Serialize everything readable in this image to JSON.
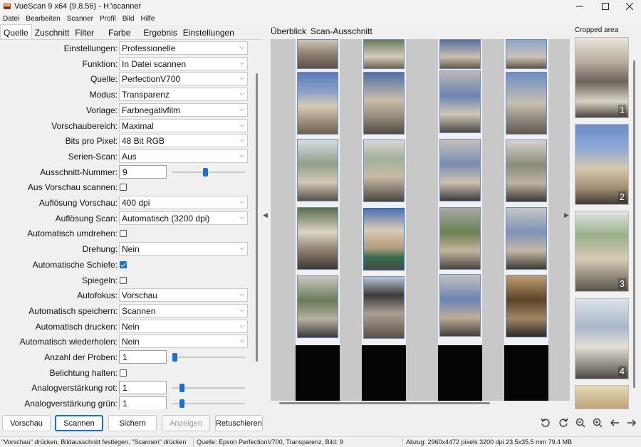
{
  "window": {
    "title": "VueScan 9 x64 (9.8.56) - H:\\scanner",
    "minimize_icon": "minimize-icon",
    "maximize_icon": "maximize-icon",
    "close_icon": "close-icon"
  },
  "menu": [
    "Datei",
    "Bearbeiten",
    "Scanner",
    "Profil",
    "Bild",
    "Hilfe"
  ],
  "tabs": [
    "Quelle",
    "Zuschnitt",
    "Filter",
    "Farbe",
    "Ergebnis",
    "Einstellungen"
  ],
  "active_tab": "Quelle",
  "form": {
    "einstellungen": {
      "label": "Einstellungen:",
      "value": "Professionelle"
    },
    "funktion": {
      "label": "Funktion:",
      "value": "In Datei scannen"
    },
    "quelle": {
      "label": "Quelle:",
      "value": "PerfectionV700"
    },
    "modus": {
      "label": "Modus:",
      "value": "Transparenz"
    },
    "vorlage": {
      "label": "Vorlage:",
      "value": "Farbnegativfilm"
    },
    "vorschaubereich": {
      "label": "Vorschaubereich:",
      "value": "Maximal"
    },
    "bits": {
      "label": "Bits pro Pixel:",
      "value": "48 Bit RGB"
    },
    "serien": {
      "label": "Serien-Scan:",
      "value": "Aus"
    },
    "ausschnitt": {
      "label": "Ausschnitt-Nummer:",
      "value": "9",
      "slider_fraction": 0.45
    },
    "aus_vorschau": {
      "label": "Aus Vorschau scannen:",
      "checked": false
    },
    "aufl_vorschau": {
      "label": "Auflösung Vorschau:",
      "value": "400 dpi"
    },
    "aufl_scan": {
      "label": "Auflösung Scan:",
      "value": "Automatisch (3200 dpi)"
    },
    "umdrehen": {
      "label": "Automatisch umdrehen:",
      "checked": false
    },
    "drehung": {
      "label": "Drehung:",
      "value": "Nein"
    },
    "schiefe": {
      "label": "Automatische Schiefe:",
      "checked": true
    },
    "spiegeln": {
      "label": "Spiegeln:",
      "checked": false
    },
    "autofokus": {
      "label": "Autofokus:",
      "value": "Vorschau"
    },
    "auto_speichern": {
      "label": "Automatisch speichern:",
      "value": "Scannen"
    },
    "auto_drucken": {
      "label": "Automatisch drucken:",
      "value": "Nein"
    },
    "auto_wiederholen": {
      "label": "Automatisch wiederholen:",
      "value": "Nein"
    },
    "proben": {
      "label": "Anzahl der Proben:",
      "value": "1",
      "slider_fraction": 0.0
    },
    "belichtung": {
      "label": "Belichtung halten:",
      "checked": false
    },
    "analog_rot": {
      "label": "Analogverstärkung rot:",
      "value": "1",
      "slider_fraction": 0.1
    },
    "analog_gruen": {
      "label": "Analogverstärkung grün:",
      "value": "1",
      "slider_fraction": 0.1
    }
  },
  "preview_tabs": [
    "Überblick",
    "Scan-Ausschnitt"
  ],
  "cropped_area": {
    "title": "Cropped area",
    "numbers": [
      "1",
      "2",
      "3",
      "4"
    ]
  },
  "buttons": {
    "vorschau": "Vorschau",
    "scannen": "Scannen",
    "sichern": "Sichern",
    "anzeigen": "Anzeigen",
    "retuschieren": "Retuschieren"
  },
  "tools": [
    "rotate-left-icon",
    "rotate-right-icon",
    "zoom-out-icon",
    "zoom-in-icon",
    "arrow-left-icon",
    "arrow-right-icon"
  ],
  "status": {
    "hint": "\"Vorschau\" drücken, Bildausschnitt festlegen, \"Scannen\" drücken",
    "source": "Quelle: Epson PerfectionV700, Transparenz, Bild: 9",
    "info": "Abzug: 2960x4472 pixels 3200 dpi 23.5x35.5 mm 79.4 MB"
  },
  "colors": {
    "accent": "#1a6fd1",
    "frame_border": "#6a8bc9"
  }
}
